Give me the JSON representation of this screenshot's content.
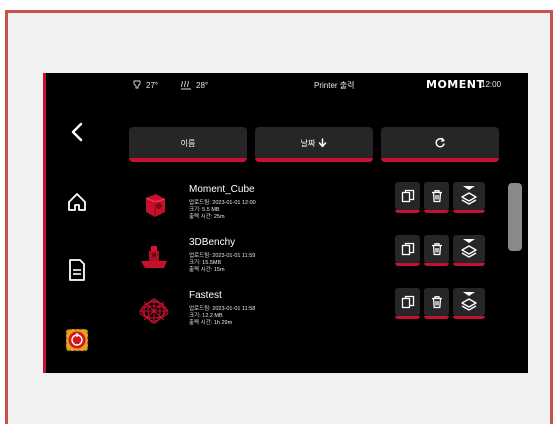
{
  "status": {
    "nozzle_temp": "27°",
    "bed_temp": "28°",
    "title": "Printer 출력",
    "brand": "MOMENT",
    "time": "12:00"
  },
  "toolbar": {
    "name_sort": "이름",
    "date_sort": "날짜",
    "date_arrow": "🡓"
  },
  "files": [
    {
      "name": "Moment_Cube",
      "upload": "업로드됨: 2023-01-01 12:00",
      "size": "크기: 5.5 MB",
      "print_time": "출력 시간: 25m"
    },
    {
      "name": "3DBenchy",
      "upload": "업로드됨: 2023-01-01 11:59",
      "size": "크기: 15.5MB",
      "print_time": "출력 시간: 15m"
    },
    {
      "name": "Fastest",
      "upload": "업로드됨: 2023-01-01 11:58",
      "size": "크기: 12.2 MB",
      "print_time": "출력 시간: 1h 29m"
    }
  ],
  "colors": {
    "accent": "#c8102e",
    "button_bg": "#262626",
    "screen_bg": "#000000"
  }
}
